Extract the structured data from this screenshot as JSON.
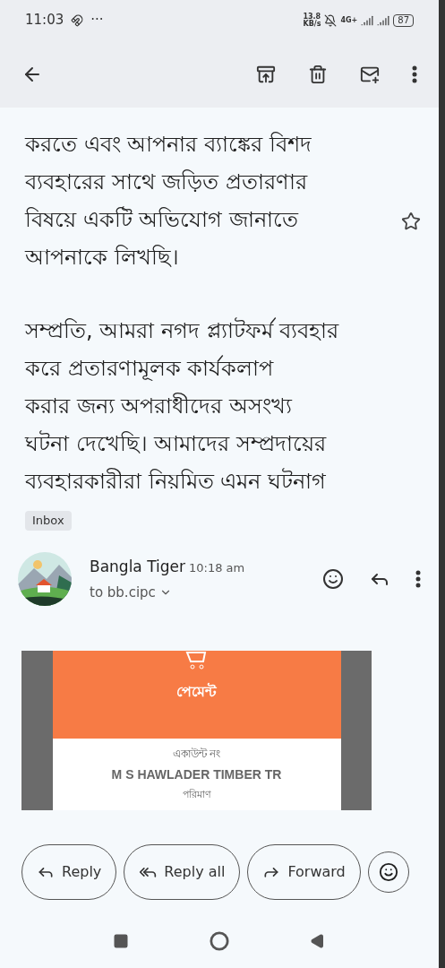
{
  "status_bar": {
    "time": "11:03",
    "overflow": "···",
    "speed_value": "13.8",
    "speed_unit": "KB/s",
    "network": "4G+",
    "battery": "87"
  },
  "email": {
    "paragraphs": [
      {
        "lines": [
          "করতে এবং আপনার ব্যাঙ্কের বিশদ",
          "ব্যবহারের সাথে জড়িত প্রতারণার",
          "বিষয়ে একটি অভিযোগ জানাতে",
          "আপনাকে লিখছি।"
        ]
      },
      {
        "lines": [
          "সম্প্রতি, আমরা নগদ প্ল্যাটফর্ম ব্যবহার",
          "করে প্রতারণামূলক কার্যকলাপ",
          "করার জন্য অপরাধীদের অসংখ্য",
          "ঘটনা দেখেছি। আমাদের সম্প্রদায়ের",
          "ব্যবহারকারীরা নিয়মিত এমন ঘটনাগ"
        ]
      }
    ],
    "starred": false,
    "label": "Inbox",
    "sender": {
      "name": "Bangla Tiger",
      "time": "10:18 am",
      "recipient": "to bb.cipc"
    },
    "attachment": {
      "title": "পেমেন্ট",
      "field_label": "একাউন্ট নং",
      "field_value": "M S HAWLADER TIMBER TR",
      "next_label": "পরিমাণ"
    }
  },
  "actions": [
    {
      "kind": "reply",
      "label": "Reply"
    },
    {
      "kind": "reply_all",
      "label": "Reply all"
    },
    {
      "kind": "forward",
      "label": "Forward"
    },
    {
      "kind": "emoji"
    }
  ]
}
